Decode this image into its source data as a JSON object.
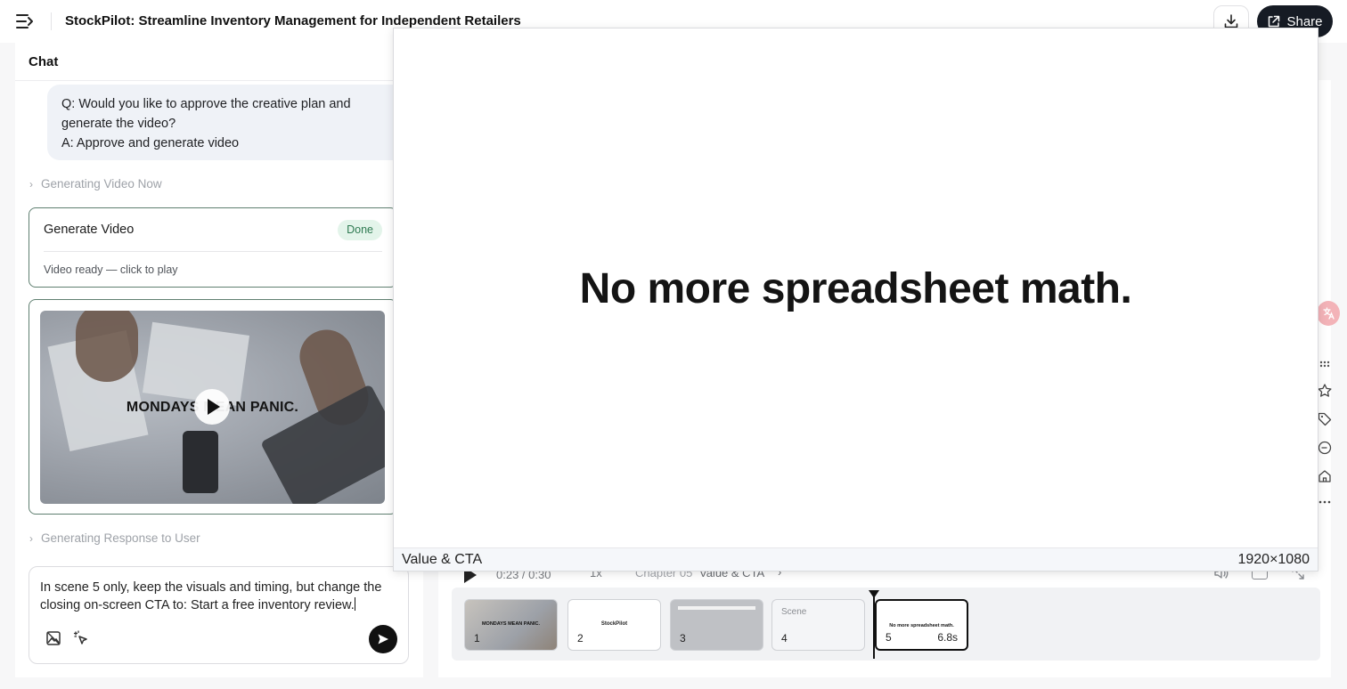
{
  "header": {
    "title": "StockPilot: Streamline Inventory Management for Independent Retailers",
    "share_label": "Share"
  },
  "chat": {
    "title": "Chat",
    "qa_lines": [
      "Q: Would you like to approve the creative plan and",
      "generate the video?",
      "A: Approve and generate video"
    ],
    "steps": [
      "Generating Video Now",
      "Generating Response to User"
    ],
    "generate_card": {
      "title": "Generate Video",
      "status": "Done",
      "subtitle": "Video ready — click to play"
    },
    "video_thumb_text": "MONDAYS MEAN PANIC.",
    "composer_text": "In scene 5 only, keep the visuals and timing, but change the closing on-screen CTA to: Start a free inventory review."
  },
  "player": {
    "time": "0:23 / 0:30",
    "speed": "1x",
    "chapter_label": "Chapter 05",
    "chapter_name": "Value & CTA"
  },
  "timeline": {
    "scenes": [
      {
        "number": "1",
        "mini_text": "MONDAYS MEAN PANIC."
      },
      {
        "number": "2",
        "mini_text": "StockPilot"
      },
      {
        "number": "3",
        "mini_text": ""
      },
      {
        "number": "4",
        "mini_text": "Scene"
      },
      {
        "number": "5",
        "mini_text": "No more spreadsheet math.",
        "duration": "6.8s"
      }
    ]
  },
  "preview": {
    "headline": "No more spreadsheet math.",
    "chapter": "Value & CTA",
    "resolution": "1920×1080"
  },
  "colors": {
    "accent_dark": "#161b24",
    "done_badge_bg": "#e3f4ea",
    "done_badge_text": "#2f7a52",
    "card_border": "#5f7f70"
  }
}
